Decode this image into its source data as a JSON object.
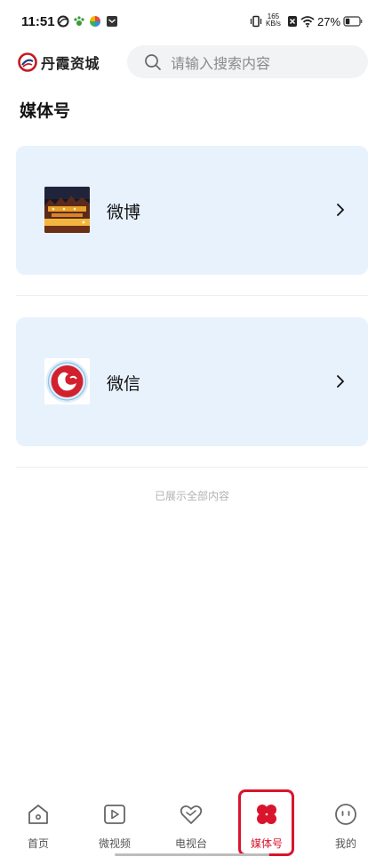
{
  "status_bar": {
    "time": "11:51",
    "net_speed_value": "165",
    "net_speed_unit": "KB/s",
    "battery_percent": "27%"
  },
  "header": {
    "logo_text": "丹霞资城",
    "search_placeholder": "请输入搜索内容"
  },
  "page_title": "媒体号",
  "media_items": [
    {
      "label": "微博",
      "icon": "weibo-thumbnail-night-city"
    },
    {
      "label": "微信",
      "icon": "wechat-thumbnail-red-emblem"
    }
  ],
  "end_of_list_text": "已展示全部内容",
  "bottom_nav": {
    "items": [
      {
        "label": "首页",
        "icon": "home-icon"
      },
      {
        "label": "微视频",
        "icon": "video-play-icon"
      },
      {
        "label": "电视台",
        "icon": "tv-heart-icon"
      },
      {
        "label": "媒体号",
        "icon": "media-clover-icon",
        "active": true
      },
      {
        "label": "我的",
        "icon": "profile-face-icon"
      }
    ]
  },
  "colors": {
    "accent": "#d8152d",
    "card_background": "#e8f2fc",
    "search_background": "#f2f3f5"
  }
}
